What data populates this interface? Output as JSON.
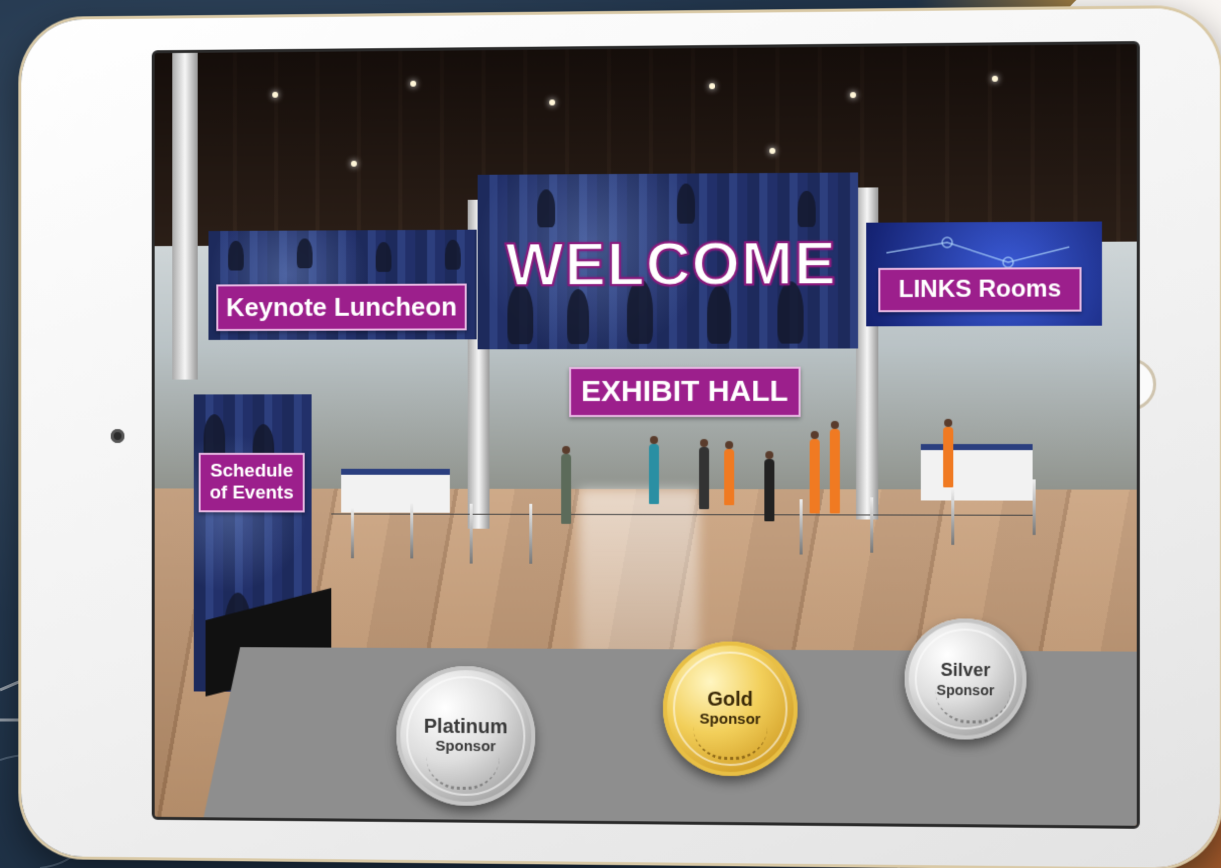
{
  "signs": {
    "welcome": "WELCOME",
    "keynote": "Keynote Luncheon",
    "links": "LINKS Rooms",
    "exhibit": "EXHIBIT HALL",
    "schedule": "Schedule of Events"
  },
  "sponsors": [
    {
      "tier": "Platinum",
      "label": "Sponsor"
    },
    {
      "tier": "Gold",
      "label": "Sponsor"
    },
    {
      "tier": "Silver",
      "label": "Sponsor"
    }
  ],
  "colors": {
    "sign_purple": "#9c1f8c",
    "board_blue": "#243369",
    "gold_medal": "#f2cf5a",
    "silver_medal": "#dedede"
  }
}
